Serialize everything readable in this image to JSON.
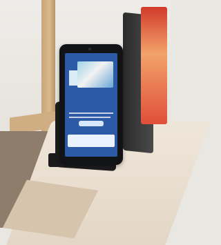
{
  "scene": {
    "description_tags": [
      "tablet",
      "stand",
      "table",
      "restaurant",
      "menu"
    ],
    "colors": {
      "tablet_bezel": "#121316",
      "screen_blue": "#2c5aa6",
      "table_top": "#efe6da",
      "wood": "#c8a57a",
      "menu_red": "#d23a2b"
    }
  }
}
